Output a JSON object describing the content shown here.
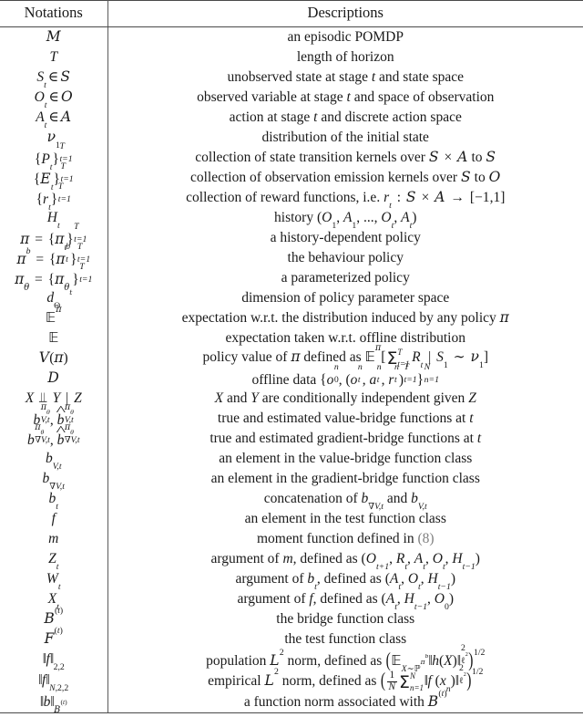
{
  "table": {
    "headers": {
      "notations": "Notations",
      "descriptions": "Descriptions"
    },
    "rows": [
      {
        "notation": "M",
        "description": "an episodic POMDP"
      },
      {
        "notation": "T",
        "description": "length of horizon"
      },
      {
        "notation": "S_t ∈ S",
        "description": "unobserved state at stage t and state space"
      },
      {
        "notation": "O_t ∈ O",
        "description": "observed variable at stage t and space of observation"
      },
      {
        "notation": "A_t ∈ A",
        "description": "action at stage t and discrete action space"
      },
      {
        "notation": "ν_1",
        "description": "distribution of the initial state"
      },
      {
        "notation": "{P_t}_{t=1}^T",
        "description": "collection of state transition kernels over S × A to S"
      },
      {
        "notation": "{E_t}_{t=1}^T",
        "description": "collection of observation emission kernels over S to O"
      },
      {
        "notation": "{r_t}_{t=1}^T",
        "description": "collection of reward functions, i.e. r_t : S × A → [−1,1]"
      },
      {
        "notation": "H_t",
        "description": "history (O_1, A_1, ..., O_t, A_t)"
      },
      {
        "notation": "π = {π_t}_{t=1}^T",
        "description": "a history-dependent policy"
      },
      {
        "notation": "π^b = {π_t^b}_{t=1}^T",
        "description": "the behaviour policy"
      },
      {
        "notation": "π_θ = {π_{θ_t}}_{t=1}^T",
        "description": "a parameterized policy"
      },
      {
        "notation": "d_Θ",
        "description": "dimension of policy parameter space"
      },
      {
        "notation": "E^π",
        "description": "expectation w.r.t. the distribution induced by any policy π"
      },
      {
        "notation": "E",
        "description": "expectation taken w.r.t. offline distribution"
      },
      {
        "notation": "V(π)",
        "description": "policy value of π defined as E^π[Σ_{t=1}^T R_t | S_1 ∼ ν_1]"
      },
      {
        "notation": "D",
        "description": "offline data {o_0^n, (o_t^n, a_t^n, r_t^n)_{t=1}^T}_{n=1}^N"
      },
      {
        "notation": "X ⊥⊥ Y | Z",
        "description": "X and Y are conditionally independent given Z"
      },
      {
        "notation": "b_{V,t}^{π_θ}, b̂_{V,t}^{π_θ}",
        "description": "true and estimated value-bridge functions at t"
      },
      {
        "notation": "b_{∇V,t}^{π_θ}, b̂_{∇V,t}^{π_θ}",
        "description": "true and estimated gradient-bridge functions at t"
      },
      {
        "notation": "b_{V,t}",
        "description": "an element in the value-bridge function class"
      },
      {
        "notation": "b_{∇V,t}",
        "description": "an element in the gradient-bridge function class"
      },
      {
        "notation": "b_t",
        "description": "concatenation of b_{∇V,t} and b_{V,t}"
      },
      {
        "notation": "f",
        "description": "an element in the test function class"
      },
      {
        "notation": "m",
        "description": "moment function defined in (8)"
      },
      {
        "notation": "Z_t",
        "description": "argument of m, defined as (O_{t+1}, R_t, A_t, O_t, H_{t−1})"
      },
      {
        "notation": "W_t",
        "description": "argument of b_t, defined as (A_t, O_t, H_{t−1})"
      },
      {
        "notation": "X_t",
        "description": "argument of f, defined as (A_t, H_{t−1}, O_0)"
      },
      {
        "notation": "B^{(t)}",
        "description": "the bridge function class"
      },
      {
        "notation": "F^{(t)}",
        "description": "the test function class"
      },
      {
        "notation": "‖f‖_{2,2}",
        "description": "population L² norm, defined as (E_{X∼P^{π^b}}‖h(X)‖_{ℓ²}^2)^{1/2}"
      },
      {
        "notation": "‖f‖_{N,2,2}",
        "description": "empirical L² norm, defined as ((1/N) Σ_{n=1}^N ‖f(x_n)‖_{ℓ²}^2)^{1/2}"
      },
      {
        "notation": "‖b‖_{B^{(t)}}",
        "description": "a function norm associated with B^{(t)}"
      }
    ],
    "reference_link_label": "(8)",
    "reference_link_color": "#808080"
  }
}
